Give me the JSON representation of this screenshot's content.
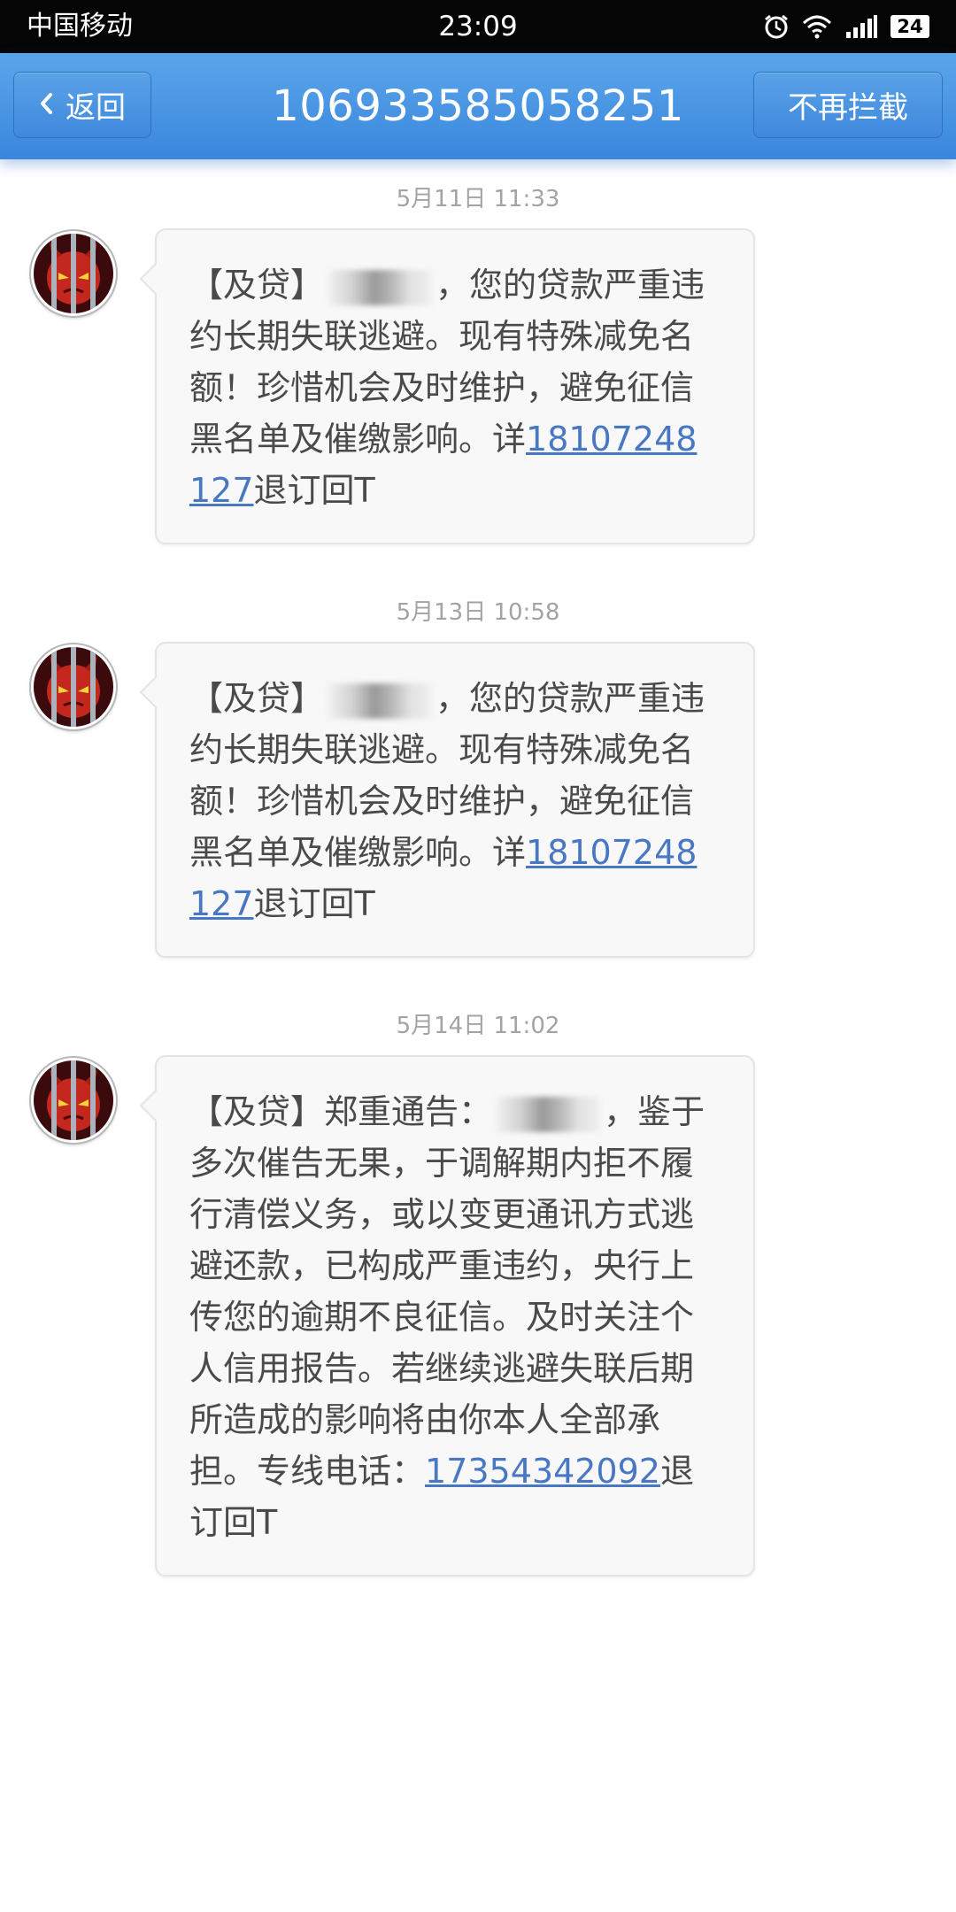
{
  "status_bar": {
    "carrier": "中国移动",
    "time": "23:09",
    "battery": "24",
    "icons": [
      "alarm-icon",
      "wifi-icon",
      "signal-icon",
      "battery-icon"
    ]
  },
  "header": {
    "back_label": "返回",
    "title": "106933585058251",
    "unblock_label": "不再拦截",
    "color": "#4a96e4"
  },
  "messages": [
    {
      "timestamp": "5月11日 11:33",
      "prefix": "【及贷】",
      "redacted_recipient": true,
      "body": "，您的贷款严重违约长期失联逃避。现有特殊减免名额！珍惜机会及时维护，避免征信黑名单及催缴影响。详",
      "phone": "18107248127",
      "suffix": "退订回T"
    },
    {
      "timestamp": "5月13日 10:58",
      "prefix": "【及贷】",
      "redacted_recipient": true,
      "body": "，您的贷款严重违约长期失联逃避。现有特殊减免名额！珍惜机会及时维护，避免征信黑名单及催缴影响。详",
      "phone": "18107248127",
      "suffix": "退订回T"
    },
    {
      "timestamp": "5月14日 11:02",
      "prefix": "【及贷】郑重通告：",
      "redacted_recipient": true,
      "body": "，鉴于多次催告无果，于调解期内拒不履行清偿义务，或以变更通讯方式逃避还款，已构成严重违约，央行上传您的逾期不良征信。及时关注个人信用报告。若继续逃避失联后期所造成的影响将由你本人全部承担。专线电话：",
      "phone": "17354342092",
      "suffix": "退订回T"
    }
  ],
  "colors": {
    "link": "#4877c4",
    "bubble_bg": "#f8f8f8",
    "timestamp": "#a3a3a3"
  }
}
